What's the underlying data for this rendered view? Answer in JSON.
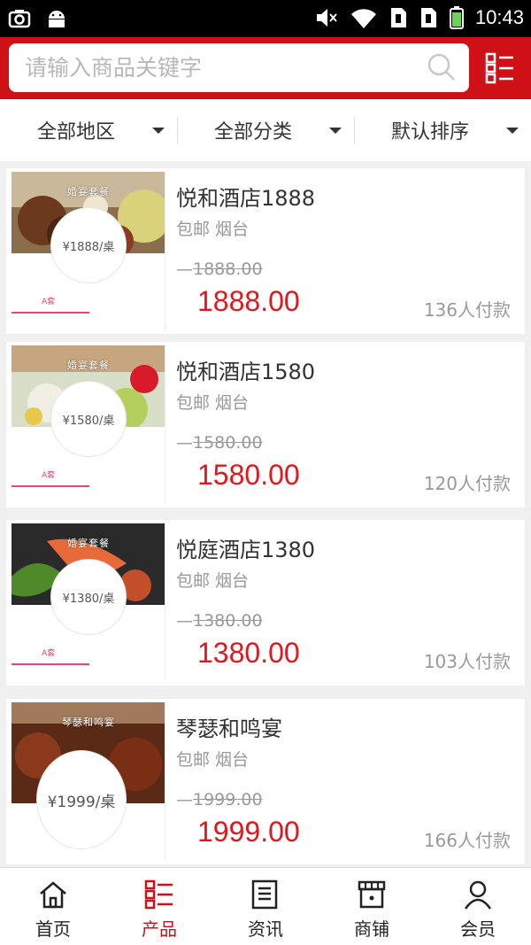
{
  "status_bar": {
    "time": "10:43"
  },
  "search": {
    "placeholder": "请输入商品关键字"
  },
  "filters": [
    {
      "label": "全部地区"
    },
    {
      "label": "全部分类"
    },
    {
      "label": "默认排序"
    }
  ],
  "products": [
    {
      "banner": "婚宴套餐",
      "badge_price": "¥1888/桌",
      "tag": "A套",
      "title": "悦和酒店1888",
      "sub": "包邮 烟台",
      "old_price": "1888.00",
      "price": "1888.00",
      "sold": "136人付款"
    },
    {
      "banner": "婚宴套餐",
      "badge_price": "¥1580/桌",
      "tag": "A套",
      "title": "悦和酒店1580",
      "sub": "包邮 烟台",
      "old_price": "1580.00",
      "price": "1580.00",
      "sold": "120人付款"
    },
    {
      "banner": "婚宴套餐",
      "badge_price": "¥1380/桌",
      "tag": "A套",
      "title": "悦庭酒店1380",
      "sub": "包邮 烟台",
      "old_price": "1380.00",
      "price": "1380.00",
      "sold": "103人付款"
    },
    {
      "banner": "琴瑟和鸣宴",
      "badge_price": "¥1999/桌",
      "title": "琴瑟和鸣宴",
      "sub": "包邮 烟台",
      "old_price": "1999.00",
      "price": "1999.00",
      "sold": "166人付款"
    }
  ],
  "tabs": [
    {
      "label": "首页",
      "icon": "home-icon"
    },
    {
      "label": "产品",
      "icon": "list-icon",
      "active": true
    },
    {
      "label": "资讯",
      "icon": "news-icon"
    },
    {
      "label": "商铺",
      "icon": "shop-icon"
    },
    {
      "label": "会员",
      "icon": "user-icon"
    }
  ],
  "colors": {
    "brand": "#cf1017",
    "price": "#e4161d",
    "tag": "#e8457a"
  }
}
